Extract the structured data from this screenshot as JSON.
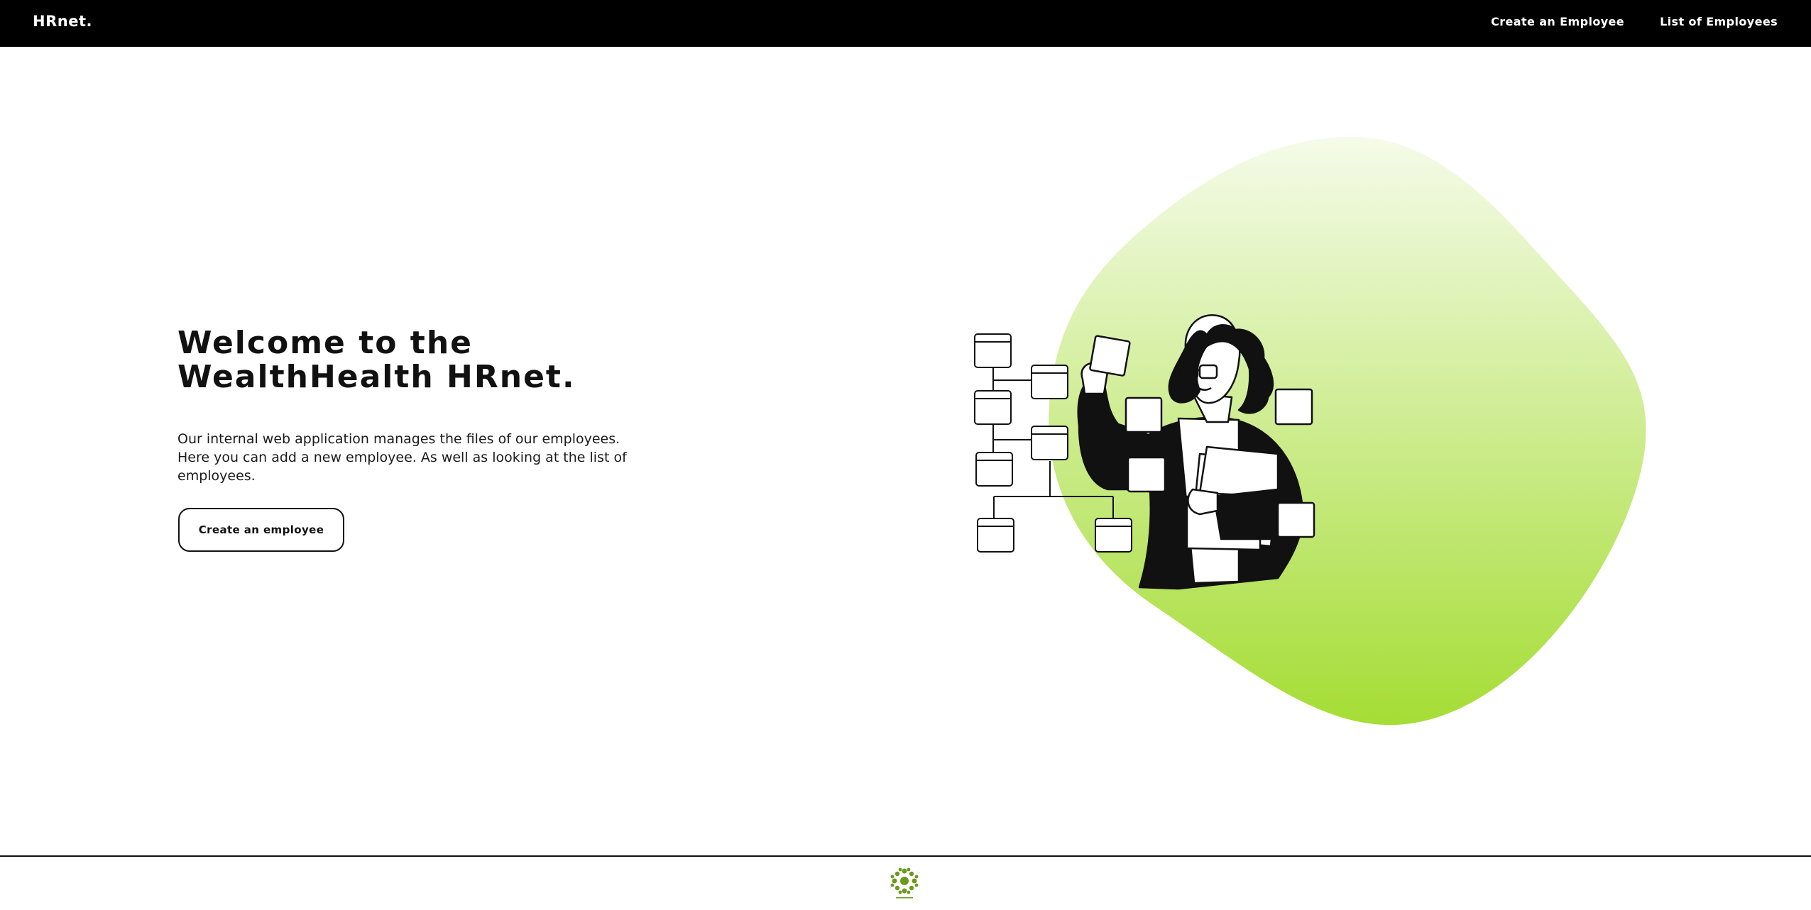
{
  "header": {
    "brand": "HRnet.",
    "nav": [
      {
        "label": "Create an Employee"
      },
      {
        "label": "List of Employees"
      }
    ]
  },
  "hero": {
    "title_line1": "Welcome to the",
    "title_line2": "WealthHealth HRnet.",
    "description": "Our internal web application manages the files of our employees. Here you can add a new employee. As well as looking at the list of employees.",
    "cta_label": "Create an employee"
  },
  "colors": {
    "header_bg": "#000000",
    "accent_light": "#f4fbe6",
    "accent_dark": "#a5dd35",
    "text": "#111111",
    "logo_green": "#6b9a1f"
  },
  "icons": {
    "illustration": "woman-organizing-chart-illustration",
    "footer_logo": "wealth-health-logo-icon"
  }
}
